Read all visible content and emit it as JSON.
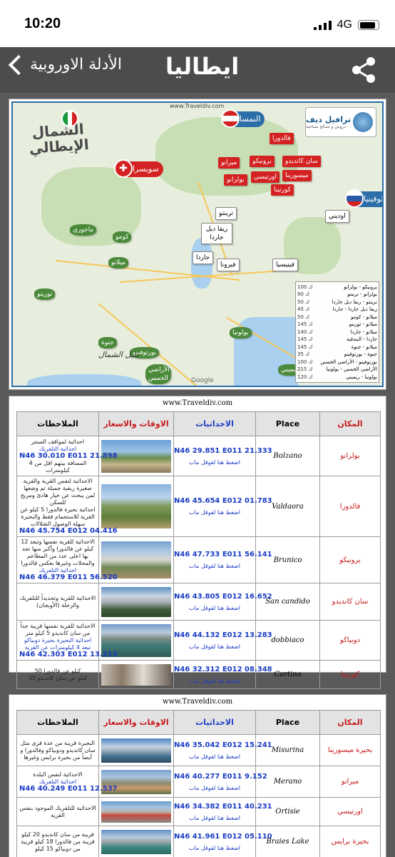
{
  "status_bar": {
    "time": "10:20",
    "network": "4G"
  },
  "nav": {
    "back_label": "الأدلة الاوروبية",
    "title": "ايطاليا"
  },
  "map": {
    "watermark": "www.Traveldiv.com",
    "brand_name": "ترافيل ديف",
    "brand_sub": "دروس و نصائح سياحية",
    "region_title_line1": "الشمال",
    "region_title_line2": "الإيطالي",
    "calligraphy": "دليل الشمال",
    "google": "Google",
    "countries": {
      "austria": "النمسا",
      "switzerland": "سويسرا",
      "slovenia": "سلوفينيا"
    },
    "red_labels": [
      {
        "name": "lbl-valdaora",
        "text": "فالدورا"
      },
      {
        "name": "lbl-san-candido",
        "text": "سان كانديدو"
      },
      {
        "name": "lbl-brunico",
        "text": "برونيكو"
      },
      {
        "name": "lbl-merano",
        "text": "ميرانو"
      },
      {
        "name": "lbl-misurina",
        "text": "ميسورينا"
      },
      {
        "name": "lbl-ortisei",
        "text": "اورتيسي"
      },
      {
        "name": "lbl-bolzano",
        "text": "بولزانو"
      },
      {
        "name": "lbl-cortina",
        "text": "كورتينا"
      }
    ],
    "white_labels": [
      {
        "name": "lbl-trento",
        "text": "ترينتو"
      },
      {
        "name": "lbl-riva",
        "text": "ريفا ديل جاردا"
      },
      {
        "name": "lbl-garda",
        "text": "جاردا"
      },
      {
        "name": "lbl-verona",
        "text": "فيرونا"
      },
      {
        "name": "lbl-venice",
        "text": "فينيسيا"
      },
      {
        "name": "lbl-udine",
        "text": "اوديني"
      }
    ],
    "green_labels": [
      {
        "name": "lbl-maggiore",
        "text": "ماجوري"
      },
      {
        "name": "lbl-como",
        "text": "كومو"
      },
      {
        "name": "lbl-milan",
        "text": "ميلانو"
      },
      {
        "name": "lbl-turin",
        "text": "تورينو"
      },
      {
        "name": "lbl-genoa",
        "text": "جنوة"
      },
      {
        "name": "lbl-portofino",
        "text": "بورتوفينو"
      },
      {
        "name": "lbl-cinque",
        "text": "الأراضي الخمس"
      },
      {
        "name": "lbl-bologna",
        "text": "بولونيا"
      },
      {
        "name": "lbl-rimini",
        "text": "ريميني"
      }
    ],
    "distances": [
      {
        "route": "برونيكو - بولزانو",
        "km": "100 ك"
      },
      {
        "route": "بولزانو - ترينتو",
        "km": "90 ك"
      },
      {
        "route": "ترينتو - ريفا ديل جاردا",
        "km": "50 ك"
      },
      {
        "route": "ريفا ديل جاردا - جاردا",
        "km": "45 ك"
      },
      {
        "route": "ميلانو - كومو",
        "km": "50 ك"
      },
      {
        "route": "ميلانو - تورينو",
        "km": "145 ك"
      },
      {
        "route": "ميلانو - جاردا",
        "km": "140 ك"
      },
      {
        "route": "جاردا - البندقية",
        "km": "145 ك"
      },
      {
        "route": "ميلانو - جنوة",
        "km": "145 ك"
      },
      {
        "route": "جنوة - بورتوفينو",
        "km": "35 ك"
      },
      {
        "route": "بورتوفينو - الأراضي الخمس",
        "km": "100 ك"
      },
      {
        "route": "الأراضي الخمس - بولونيا",
        "km": "215 ك"
      },
      {
        "route": "بولونيا - ريميني",
        "km": "120 ك"
      }
    ]
  },
  "table_headers": {
    "notes": "الملاحظات",
    "times": "الاوقات والاسعار",
    "coords": "الاحداثيات",
    "place": "Place",
    "location": "المكان"
  },
  "site": "www.Traveldiv.com",
  "table1": [
    {
      "notes": [
        "احداثية لمواقف السنتر"
      ],
      "notes_blue": "احداثية التلفريك",
      "notes_big": "N46 30.010 E011 21.898",
      "notes_tail": "المسافة بينهم اقل من 4 كيلومترات",
      "coord": "N46 29.851 E011 21.333",
      "link": "اضغط هنا لقوقل ماب",
      "place": "Bolzano",
      "location": "بولزانو",
      "img": "linear-gradient(#6da0d4 0%,#9cc3e6 35%,#6b8c4d 55%,#c7b58f 75%,#8a7a5c 100%)"
    },
    {
      "notes": [
        "الاحداثية لنفس القرية والقرية صغيرة ريفية جميلة تم وضعها لمن يبحث عن خيار هادئ ومريح للسكن",
        "احداثية بحيرة فالدورا 5 كيلو عن القرية للاستجمام فقط والبحيرة سهلة الوصول الشلالات"
      ],
      "notes_blue": "",
      "notes_big": "N46 45.754 E012 04.416",
      "notes_tail": "",
      "coord": "N46 45.654 E012 01.783",
      "link": "اضغط هنا لقوقل ماب",
      "place": "Valdaora",
      "location": "فالدورا",
      "img": "linear-gradient(#8db5dc 0%,#b9d3ec 30%,#7e9a5a 50%,#5e7d3a 75%,#b59e73 100%)"
    },
    {
      "notes": [
        "الاحداثية للقرية نفسها وتبعد 12 كيلو عن فالدورا وأكبر منها تجد بها اعلى عدد من المطاعم والمحلات وغيرها بعكس فالدورا"
      ],
      "notes_blue": "احداثية التلفريك",
      "notes_big": "N46 46.379 E011 56.520",
      "notes_tail": "",
      "coord": "N46 47.733 E011 56.141",
      "link": "اضغط هنا لقوقل ماب",
      "place": "Brunico",
      "location": "برونيكو",
      "img": "linear-gradient(#7aa3cf 0%,#b2cbe4 30%,#d8d6cf 50%,#6f8856 70%,#a68c6a 100%)"
    },
    {
      "notes": [
        "الاحداثية للقرية وتحديداً للتلفريك والرحلة (الأوبجان)"
      ],
      "notes_blue": "",
      "notes_big": "",
      "notes_tail": "",
      "coord": "N46 43.805 E012 16.652",
      "link": "اضغط هنا لقوقل ماب",
      "place": "San candido",
      "location": "سان كانديدو",
      "img": "linear-gradient(#5f8fc4 0%,#c9d5e1 30%,#aab0b6 50%,#3d5a3a 75%,#2f4a2c 100%)"
    },
    {
      "notes": [
        "الاحداثية للقرية نفسها قريبة جداً من سان كانديدو 5 كيلو متر"
      ],
      "notes_blue": "احداثية البحيرة بحيرة دوبياكو تبعد 4 كيلومترات عن القرية",
      "notes_big": "N46 42.303 E012 13.213",
      "notes_tail": "",
      "coord": "N46 44.132 E012 13.283",
      "link": "اضغط هنا لقوقل ماب",
      "place": "dobbiaco",
      "location": "دوبياكو",
      "img": "linear-gradient(#6f98c8 0%,#b8cbdc 25%,#7a8a84 45%,#3f7a77 65%,#2f5c55 100%)"
    },
    {
      "notes": [
        "50 كيلو عن فالدورا",
        "35 كيلو عن سان كانديدو"
      ],
      "notes_blue": "",
      "notes_big": "",
      "notes_tail": "",
      "coord": "N46 32.312 E012 08.348",
      "link": "اضغط هنا لقوقل ماب",
      "place": "Cortina",
      "location": "كورتينا",
      "img": "linear-gradient(90deg,#c8c0b3 0%,#8a7a68 30%,#e2dcd2 60%,#6d6258 100%)"
    }
  ],
  "table2": [
    {
      "notes": [
        "البحيرة قريبة من عدة قرى مثل سان كانديدو ودوبياكو وفالدورا و أيضاً من بحيرة برايس وغيرها"
      ],
      "notes_blue": "",
      "notes_big": "",
      "notes_tail": "",
      "coord": "N46 35.042 E012 15.241",
      "link": "اضغط هنا لقوقل ماب",
      "place": "Misurina",
      "location": "بحيرة ميسورينا",
      "img": "linear-gradient(#4f86c6 0%,#c3d3e3 35%,#8a9fb0 55%,#3e6f8f 75%,#2f4e63 100%)"
    },
    {
      "notes": [
        "الاحداثية لنفس البلدة"
      ],
      "notes_blue": "احداثية التلفريك",
      "notes_big": "N46 40.249 E011 12.537",
      "notes_tail": "",
      "coord": "N46 40.277 E011 9.152",
      "link": "اضغط هنا لقوقل ماب",
      "place": "Merano",
      "location": "ميرانو",
      "img": "linear-gradient(#7aa3cf 0%,#a9c2dc 30%,#8f8a72 55%,#c89b6c 75%,#5f6e4b 100%)"
    },
    {
      "notes": [
        "الاحداثية للتلفريك الموجود بنفس القرية"
      ],
      "notes_blue": "",
      "notes_big": "",
      "notes_tail": "",
      "coord": "N46 34.382 E011 40.231",
      "link": "اضغط هنا لقوقل ماب",
      "place": "Ortisie",
      "location": "اورتيسي",
      "img": "linear-gradient(#6f9cd0 0%,#a7c4e2 30%,#b9b1a4 50%,#c74a3e 65%,#8a8a8a 100%)"
    },
    {
      "notes": [
        "قريبة من سان كانديدو 20 كيلو قريبة من فالدورا 18 كيلو قريبة من دوبياكو 15 كيلو"
      ],
      "notes_blue": "",
      "notes_big": "",
      "notes_tail": "",
      "coord": "N46 41.961 E012 05.110",
      "link": "اضغط هنا لقوقل ماب",
      "place": "Braies Lake",
      "location": "بحيرة برايس",
      "img": "linear-gradient(#5f8fc4 0%,#b8cbe0 30%,#9aa4a8 50%,#3e8a84 70%,#2f6b63 100%)"
    }
  ]
}
